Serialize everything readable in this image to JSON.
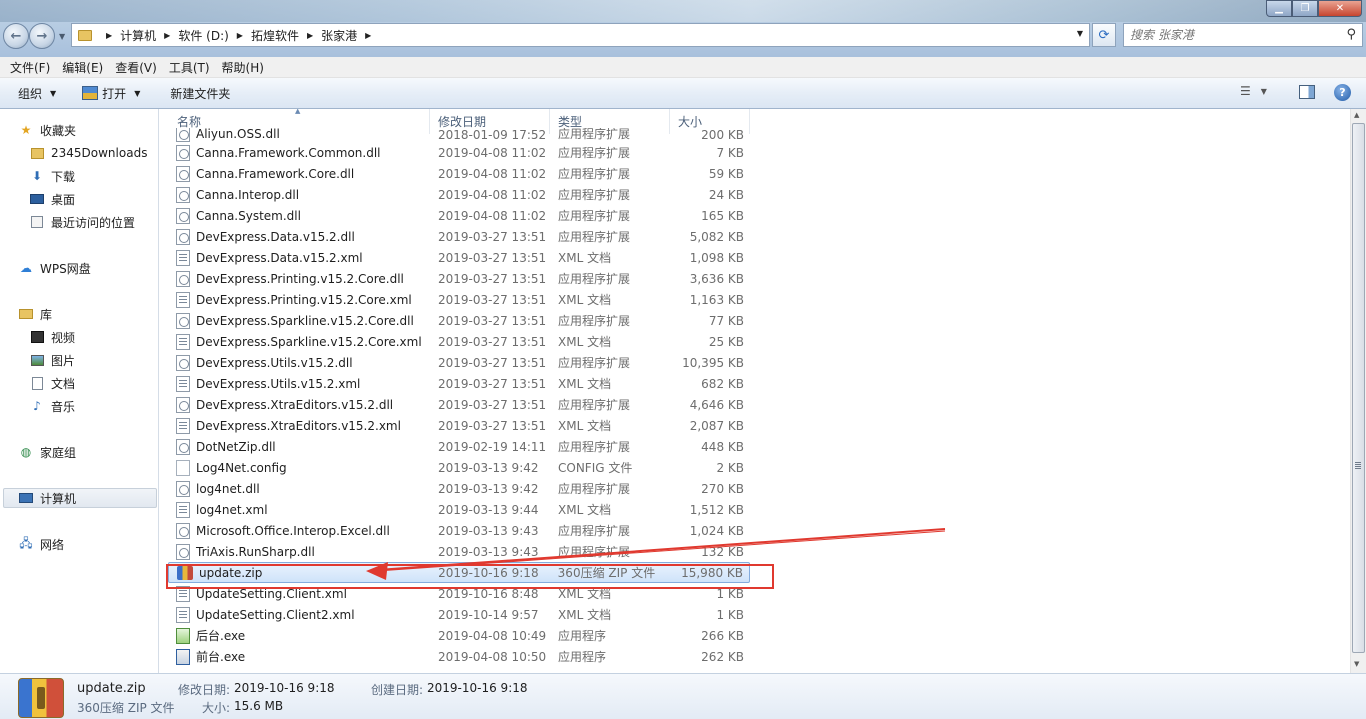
{
  "address": {
    "crumbs": [
      "计算机",
      "软件 (D:)",
      "拓煌软件",
      "张家港"
    ],
    "search_placeholder": "搜索 张家港"
  },
  "menu": [
    "文件(F)",
    "编辑(E)",
    "查看(V)",
    "工具(T)",
    "帮助(H)"
  ],
  "toolbar": {
    "organize": "组织",
    "open": "打开",
    "new_folder": "新建文件夹"
  },
  "nav": {
    "favorites": "收藏夹",
    "downloads_2345": "2345Downloads",
    "downloads": "下载",
    "desktop": "桌面",
    "recent": "最近访问的位置",
    "wps": "WPS网盘",
    "libraries": "库",
    "videos": "视频",
    "pictures": "图片",
    "documents": "文档",
    "music": "音乐",
    "homegroup": "家庭组",
    "computer": "计算机",
    "network": "网络"
  },
  "columns": {
    "name": "名称",
    "date": "修改日期",
    "type": "类型",
    "size": "大小"
  },
  "files": [
    {
      "name": "Aliyun.OSS.dll",
      "date": "2018-01-09 17:52",
      "type": "应用程序扩展",
      "size": "200 KB",
      "icon": "dll"
    },
    {
      "name": "Canna.Framework.Common.dll",
      "date": "2019-04-08 11:02",
      "type": "应用程序扩展",
      "size": "7 KB",
      "icon": "dll"
    },
    {
      "name": "Canna.Framework.Core.dll",
      "date": "2019-04-08 11:02",
      "type": "应用程序扩展",
      "size": "59 KB",
      "icon": "dll"
    },
    {
      "name": "Canna.Interop.dll",
      "date": "2019-04-08 11:02",
      "type": "应用程序扩展",
      "size": "24 KB",
      "icon": "dll"
    },
    {
      "name": "Canna.System.dll",
      "date": "2019-04-08 11:02",
      "type": "应用程序扩展",
      "size": "165 KB",
      "icon": "dll"
    },
    {
      "name": "DevExpress.Data.v15.2.dll",
      "date": "2019-03-27 13:51",
      "type": "应用程序扩展",
      "size": "5,082 KB",
      "icon": "dll"
    },
    {
      "name": "DevExpress.Data.v15.2.xml",
      "date": "2019-03-27 13:51",
      "type": "XML 文档",
      "size": "1,098 KB",
      "icon": "xml"
    },
    {
      "name": "DevExpress.Printing.v15.2.Core.dll",
      "date": "2019-03-27 13:51",
      "type": "应用程序扩展",
      "size": "3,636 KB",
      "icon": "dll"
    },
    {
      "name": "DevExpress.Printing.v15.2.Core.xml",
      "date": "2019-03-27 13:51",
      "type": "XML 文档",
      "size": "1,163 KB",
      "icon": "xml"
    },
    {
      "name": "DevExpress.Sparkline.v15.2.Core.dll",
      "date": "2019-03-27 13:51",
      "type": "应用程序扩展",
      "size": "77 KB",
      "icon": "dll"
    },
    {
      "name": "DevExpress.Sparkline.v15.2.Core.xml",
      "date": "2019-03-27 13:51",
      "type": "XML 文档",
      "size": "25 KB",
      "icon": "xml"
    },
    {
      "name": "DevExpress.Utils.v15.2.dll",
      "date": "2019-03-27 13:51",
      "type": "应用程序扩展",
      "size": "10,395 KB",
      "icon": "dll"
    },
    {
      "name": "DevExpress.Utils.v15.2.xml",
      "date": "2019-03-27 13:51",
      "type": "XML 文档",
      "size": "682 KB",
      "icon": "xml"
    },
    {
      "name": "DevExpress.XtraEditors.v15.2.dll",
      "date": "2019-03-27 13:51",
      "type": "应用程序扩展",
      "size": "4,646 KB",
      "icon": "dll"
    },
    {
      "name": "DevExpress.XtraEditors.v15.2.xml",
      "date": "2019-03-27 13:51",
      "type": "XML 文档",
      "size": "2,087 KB",
      "icon": "xml"
    },
    {
      "name": "DotNetZip.dll",
      "date": "2019-02-19 14:11",
      "type": "应用程序扩展",
      "size": "448 KB",
      "icon": "dll"
    },
    {
      "name": "Log4Net.config",
      "date": "2019-03-13 9:42",
      "type": "CONFIG 文件",
      "size": "2 KB",
      "icon": "cfg"
    },
    {
      "name": "log4net.dll",
      "date": "2019-03-13 9:42",
      "type": "应用程序扩展",
      "size": "270 KB",
      "icon": "dll"
    },
    {
      "name": "log4net.xml",
      "date": "2019-03-13 9:44",
      "type": "XML 文档",
      "size": "1,512 KB",
      "icon": "xml"
    },
    {
      "name": "Microsoft.Office.Interop.Excel.dll",
      "date": "2019-03-13 9:43",
      "type": "应用程序扩展",
      "size": "1,024 KB",
      "icon": "dll"
    },
    {
      "name": "TriAxis.RunSharp.dll",
      "date": "2019-03-13 9:43",
      "type": "应用程序扩展",
      "size": "132 KB",
      "icon": "dll"
    },
    {
      "name": "update.zip",
      "date": "2019-10-16 9:18",
      "type": "360压缩 ZIP 文件",
      "size": "15,980 KB",
      "icon": "zip",
      "selected": true
    },
    {
      "name": "UpdateSetting.Client.xml",
      "date": "2019-10-16 8:48",
      "type": "XML 文档",
      "size": "1 KB",
      "icon": "xml"
    },
    {
      "name": "UpdateSetting.Client2.xml",
      "date": "2019-10-14 9:57",
      "type": "XML 文档",
      "size": "1 KB",
      "icon": "xml"
    },
    {
      "name": "后台.exe",
      "date": "2019-04-08 10:49",
      "type": "应用程序",
      "size": "266 KB",
      "icon": "exe"
    },
    {
      "name": "前台.exe",
      "date": "2019-04-08 10:50",
      "type": "应用程序",
      "size": "262 KB",
      "icon": "exe2"
    }
  ],
  "details": {
    "name": "update.zip",
    "type": "360压缩 ZIP 文件",
    "modified_label": "修改日期:",
    "modified": "2019-10-16 9:18",
    "created_label": "创建日期:",
    "created": "2019-10-16 9:18",
    "size_label": "大小:",
    "size": "15.6 MB"
  },
  "annotation_color": "#e0392f"
}
